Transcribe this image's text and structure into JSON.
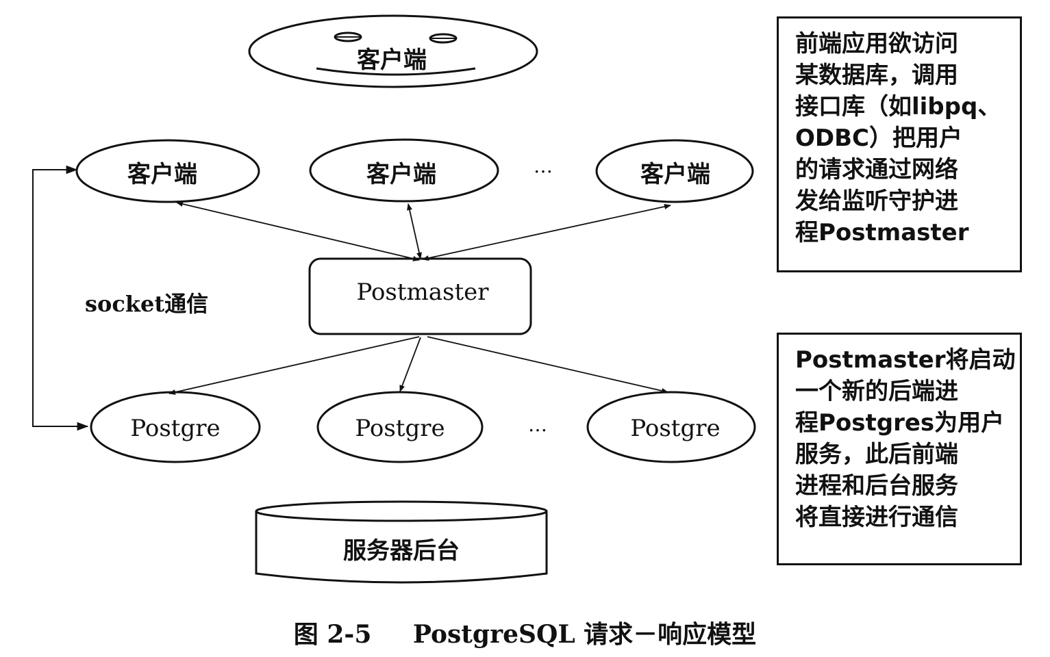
{
  "client_top": {
    "label": "客户端"
  },
  "clients": [
    {
      "label": "客户端"
    },
    {
      "label": "客户端"
    },
    {
      "label": "客户端"
    }
  ],
  "client_ellipsis": "…",
  "postmaster": {
    "label": "Postmaster"
  },
  "socket_label": "socket通信",
  "backends": [
    {
      "label": "Postgre"
    },
    {
      "label": "Postgre"
    },
    {
      "label": "Postgre"
    }
  ],
  "backend_ellipsis": "…",
  "server_backend": {
    "label": "服务器后台"
  },
  "notes": [
    {
      "lines": [
        "前端应用欲访问",
        "某数据库，调用",
        "接口库（如libpq、",
        "ODBC）把用户",
        "的请求通过网络",
        "发给监听守护进",
        "程Postmaster"
      ]
    },
    {
      "lines": [
        "Postmaster将启动",
        "一个新的后端进",
        "程Postgres为用户",
        "服务，此后前端",
        "进程和后台服务",
        "将直接进行通信"
      ]
    }
  ],
  "caption": {
    "number": "图 2-5",
    "title": "PostgreSQL 请求－响应模型"
  }
}
